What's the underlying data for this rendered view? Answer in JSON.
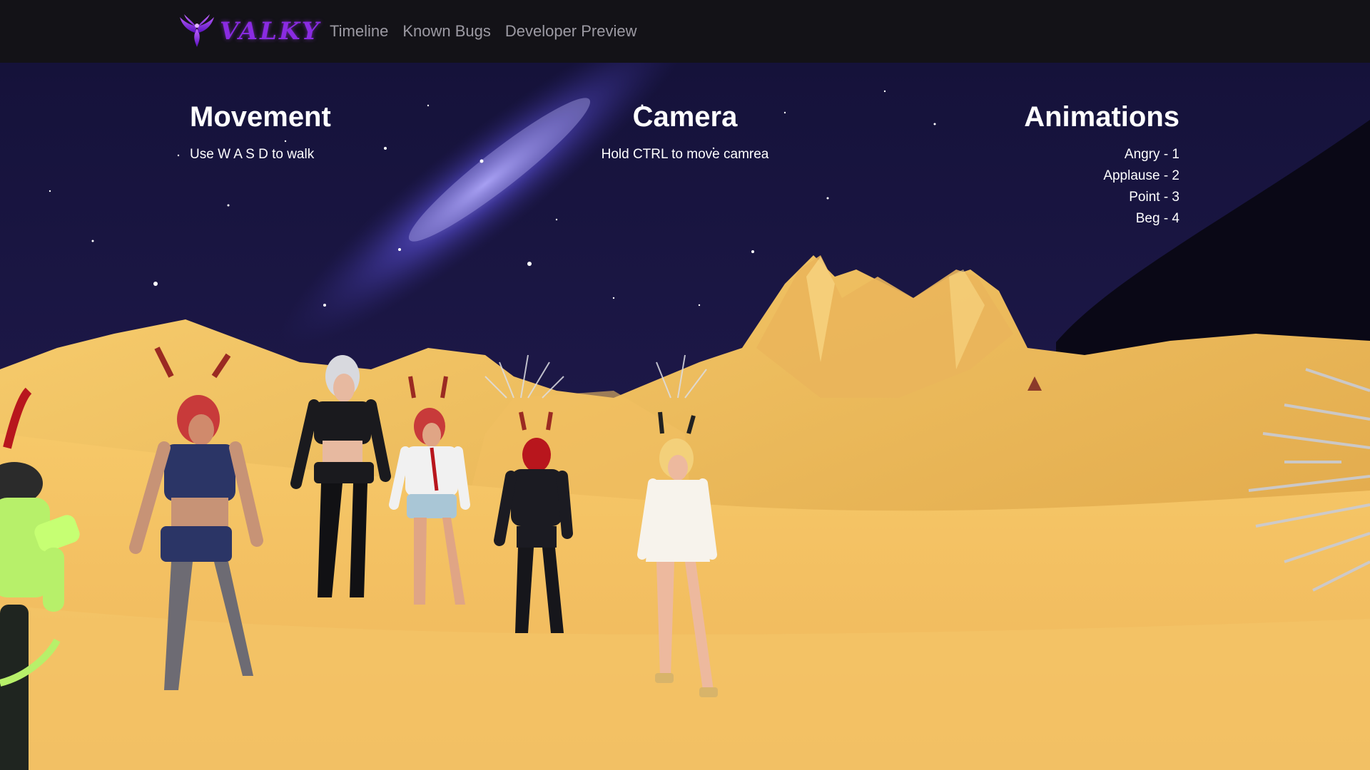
{
  "navbar": {
    "brand_name": "VALKY",
    "brand_color": "#8a2be2",
    "links": [
      {
        "label": "Timeline"
      },
      {
        "label": "Known Bugs"
      },
      {
        "label": "Developer Preview"
      }
    ]
  },
  "hud": {
    "movement": {
      "title": "Movement",
      "lines": [
        "Use W A S D to walk"
      ]
    },
    "camera": {
      "title": "Camera",
      "lines": [
        "Hold CTRL to move camrea"
      ]
    },
    "animations": {
      "title": "Animations",
      "lines": [
        "Angry - 1",
        "Applause - 2",
        "Point - 3",
        "Beg - 4"
      ]
    }
  },
  "scene": {
    "sky_color": "#0d0b2a",
    "milky_way_color": "#6b5cff",
    "terrain_color": "#f2bd5c",
    "terrain_shadow_color": "#d99e3c",
    "characters": [
      {
        "name": "green-armored-character",
        "outfit_color": "#b7f06a"
      },
      {
        "name": "red-haired-police-character",
        "outfit_color": "#2b3566"
      },
      {
        "name": "silver-haired-leather-character",
        "outfit_color": "#1a1a1e"
      },
      {
        "name": "red-haired-shirt-character",
        "outfit_color": "#f1f1f1"
      },
      {
        "name": "black-armored-character",
        "outfit_color": "#1b1b22"
      },
      {
        "name": "white-dress-character",
        "outfit_color": "#f7f3ec"
      }
    ]
  }
}
